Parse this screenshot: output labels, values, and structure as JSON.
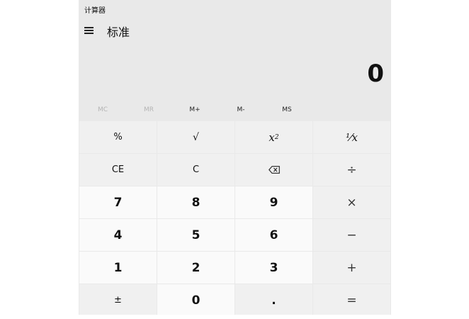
{
  "window": {
    "title": "计算器"
  },
  "header": {
    "mode_title": "标准"
  },
  "display": {
    "value": "0"
  },
  "memory": {
    "mc": "MC",
    "mr": "MR",
    "mplus": "M+",
    "mminus": "M-",
    "ms": "MS"
  },
  "keys": {
    "percent": "%",
    "sqrt": "√",
    "square_base": "x",
    "square_exp": "2",
    "reciprocal": "⅟x",
    "ce": "CE",
    "c": "C",
    "backspace": "⌫",
    "divide": "÷",
    "seven": "7",
    "eight": "8",
    "nine": "9",
    "multiply": "×",
    "four": "4",
    "five": "5",
    "six": "6",
    "minus": "−",
    "one": "1",
    "two": "2",
    "three": "3",
    "plus": "+",
    "negate": "±",
    "zero": "0",
    "decimal": ".",
    "equals": "="
  }
}
